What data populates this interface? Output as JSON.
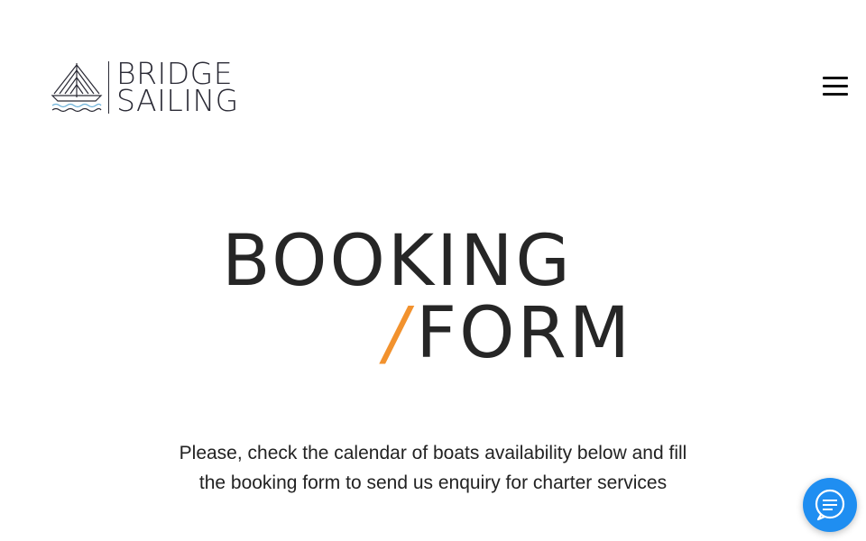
{
  "brand": {
    "line1": "BRIDGE",
    "line2": "SAILING",
    "logo_icon": "sailboat-bridge-icon"
  },
  "nav": {
    "menu_icon": "hamburger-menu-icon"
  },
  "hero": {
    "title_line1": "BOOKING",
    "slash": "/",
    "title_line2": "FORM",
    "accent_color": "#f2922e"
  },
  "intro": {
    "line1": "Please, check the calendar of boats availability below and fill",
    "line2": "the booking form to send us enquiry for charter services"
  },
  "chat": {
    "icon": "chat-bubble-icon",
    "color": "#1f8ef1"
  }
}
